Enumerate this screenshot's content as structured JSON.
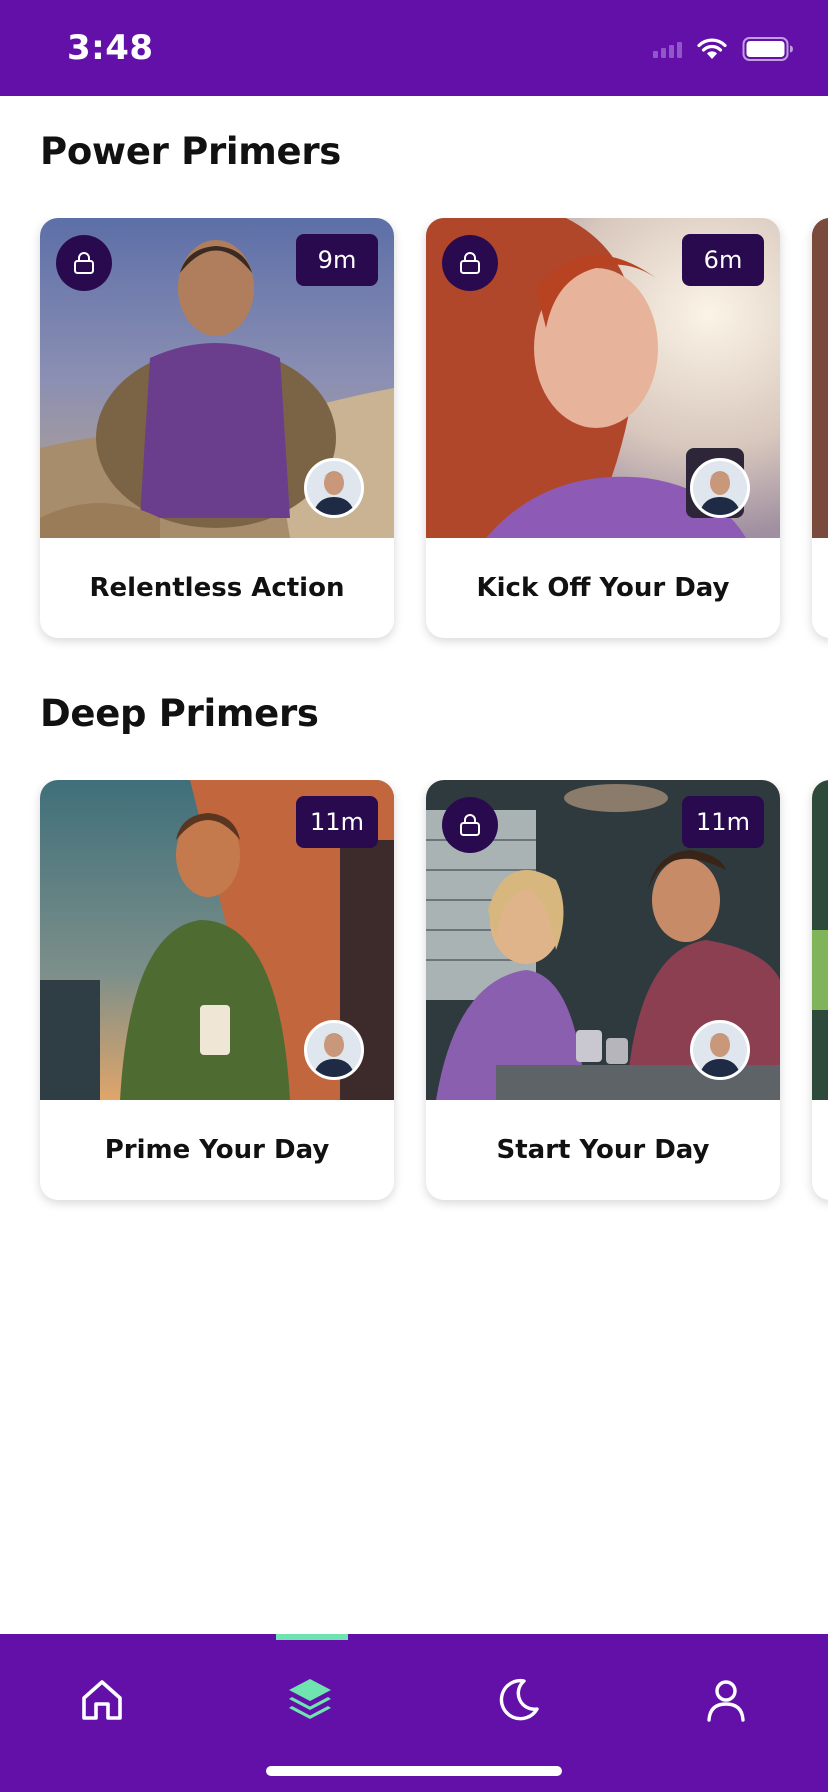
{
  "status_bar": {
    "time": "3:48"
  },
  "sections": [
    {
      "title": "Power Primers",
      "cards": [
        {
          "title": "Relentless Action",
          "duration": "9m",
          "locked": true
        },
        {
          "title": "Kick Off Your Day",
          "duration": "6m",
          "locked": true
        }
      ]
    },
    {
      "title": "Deep Primers",
      "cards": [
        {
          "title": "Prime Your Day",
          "duration": "11m",
          "locked": false
        },
        {
          "title": "Start Your Day",
          "duration": "11m",
          "locked": true
        }
      ]
    }
  ],
  "tab_bar": {
    "items": [
      {
        "icon": "home-icon",
        "active": false
      },
      {
        "icon": "layers-icon",
        "active": true
      },
      {
        "icon": "moon-icon",
        "active": false
      },
      {
        "icon": "profile-icon",
        "active": false
      }
    ]
  },
  "colors": {
    "brand": "#6210a8",
    "badge": "#2a0a4f",
    "accent": "#6fe3b0"
  }
}
